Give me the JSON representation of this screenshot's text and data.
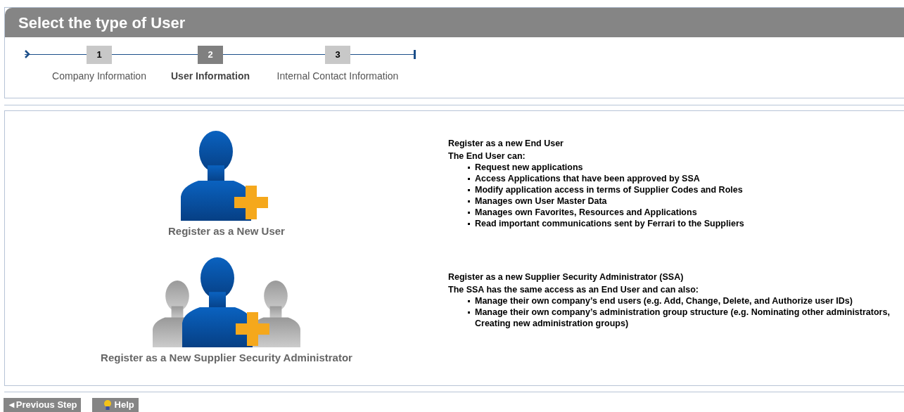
{
  "header": {
    "title": "Select the type of User"
  },
  "steps": [
    {
      "number": "1",
      "label": "Company Information",
      "selected": false
    },
    {
      "number": "2",
      "label": "User Information",
      "selected": true
    },
    {
      "number": "3",
      "label": "Internal Contact Information",
      "selected": false
    }
  ],
  "options": [
    {
      "kind": "single",
      "caption": "Register as a New User",
      "heading": "Register as a new End User",
      "intro": "The End User can:",
      "bullets": [
        "Request new applications",
        "Access Applications that have been approved by SSA",
        "Modify application access in terms of Supplier Codes and Roles",
        "Manages own User Master Data",
        "Manages own Favorites, Resources and Applications",
        "Read important communications sent by Ferrari to the Suppliers"
      ]
    },
    {
      "kind": "group",
      "caption": "Register as a New Supplier Security Administrator",
      "heading": "Register as a new Supplier Security Administrator (SSA)",
      "intro": "The SSA has the same access as an End User and can also:",
      "bullets": [
        "Manage their own company’s end users (e.g. Add, Change, Delete, and Authorize user IDs)",
        "Manage their own company’s administration group structure (e.g. Nominating other administrators, Creating new administration groups)"
      ]
    }
  ],
  "footer": {
    "previous": "◄Previous Step",
    "help": "Help"
  }
}
